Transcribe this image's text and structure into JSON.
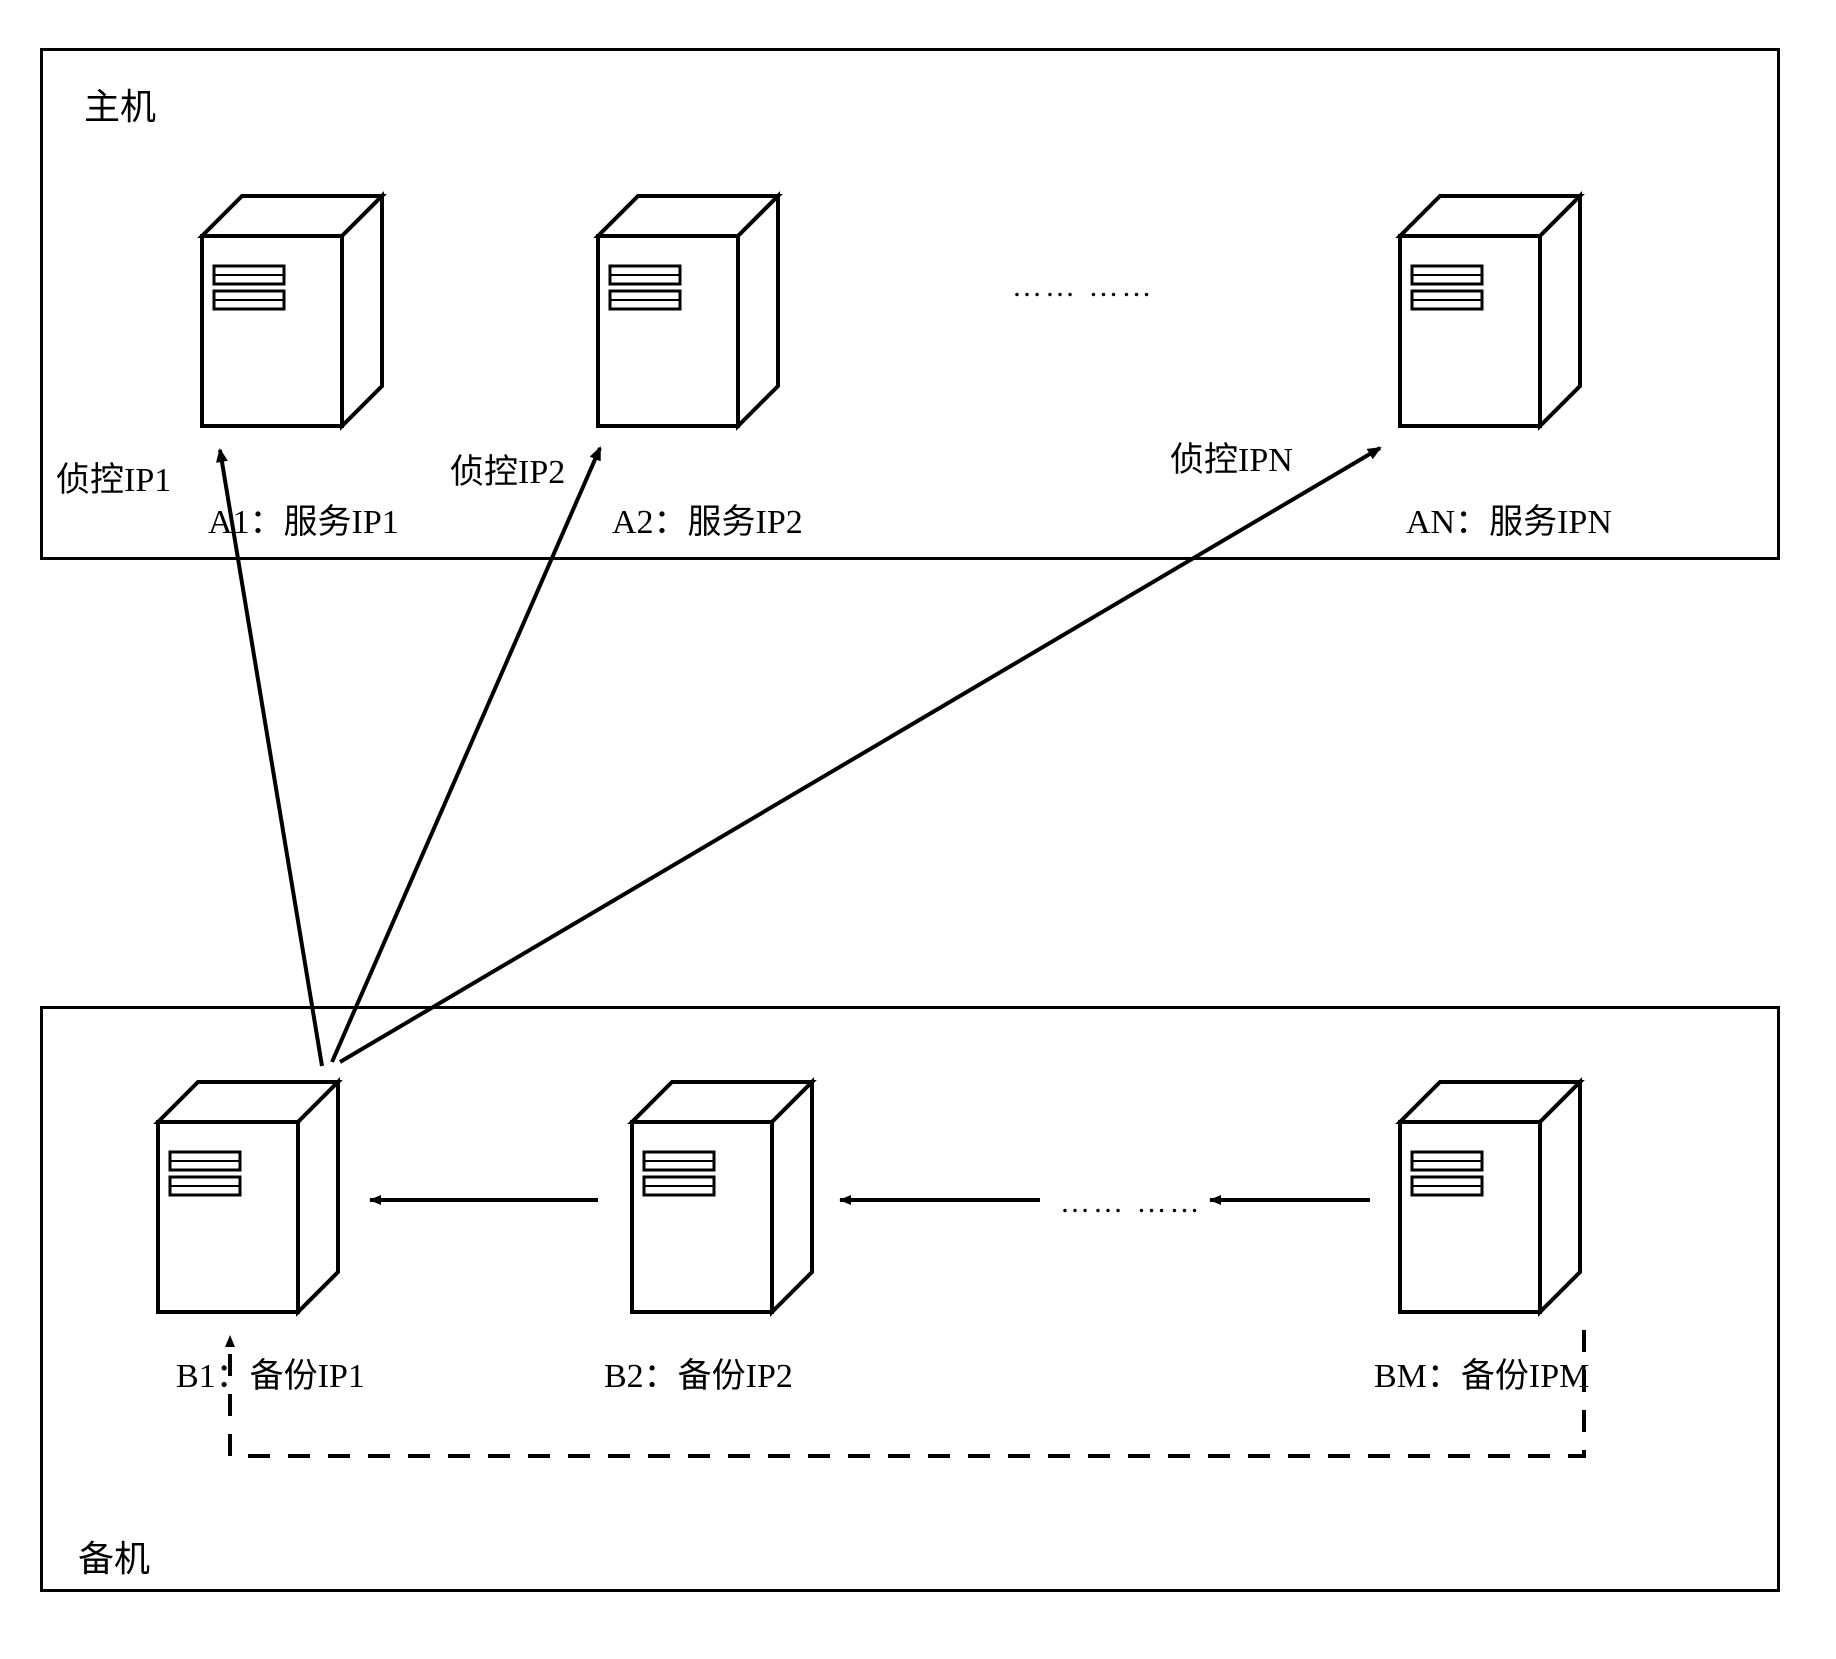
{
  "groups": {
    "primary": {
      "label": "主机"
    },
    "standby": {
      "label": "备机"
    }
  },
  "primary_servers": {
    "a1": {
      "monitor_label": "侦控IP1",
      "name_label": "A1：服务IP1"
    },
    "a2": {
      "monitor_label": "侦控IP2",
      "name_label": "A2：服务IP2"
    },
    "an": {
      "monitor_label": "侦控IPN",
      "name_label": "AN：服务IPN"
    }
  },
  "standby_servers": {
    "b1": {
      "name_label": "B1：备份IP1"
    },
    "b2": {
      "name_label": "B2：备份IP2"
    },
    "bm": {
      "name_label": "BM：备份IPM"
    }
  },
  "ellipsis": {
    "top": "…… ……",
    "mid": "…… ……"
  }
}
